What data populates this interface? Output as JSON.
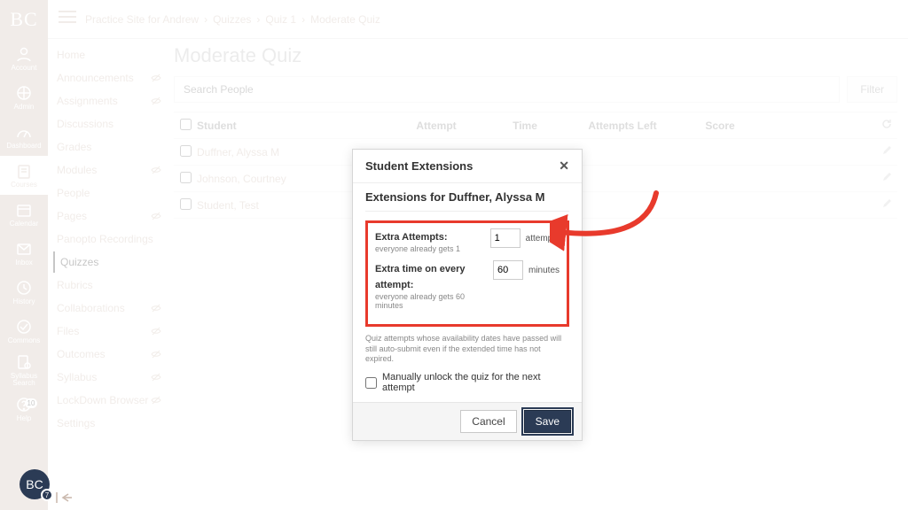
{
  "brand": "BC",
  "global_nav": [
    {
      "id": "account",
      "label": "Account"
    },
    {
      "id": "admin",
      "label": "Admin"
    },
    {
      "id": "dashboard",
      "label": "Dashboard"
    },
    {
      "id": "courses",
      "label": "Courses"
    },
    {
      "id": "calendar",
      "label": "Calendar"
    },
    {
      "id": "inbox",
      "label": "Inbox"
    },
    {
      "id": "history",
      "label": "History"
    },
    {
      "id": "commons",
      "label": "Commons"
    },
    {
      "id": "syllabus-search",
      "label": "Syllabus Search"
    },
    {
      "id": "help",
      "label": "Help",
      "badge": "10"
    }
  ],
  "global_nav_active": "courses",
  "breadcrumbs": [
    "Practice Site for Andrew",
    "Quizzes",
    "Quiz 1",
    "Moderate Quiz"
  ],
  "course_nav": {
    "items": [
      {
        "label": "Home"
      },
      {
        "label": "Announcements",
        "hidden": true
      },
      {
        "label": "Assignments",
        "hidden": true
      },
      {
        "label": "Discussions"
      },
      {
        "label": "Grades"
      },
      {
        "label": "Modules",
        "hidden": true
      },
      {
        "label": "People"
      },
      {
        "label": "Pages",
        "hidden": true
      },
      {
        "label": "Panopto Recordings"
      },
      {
        "label": "Quizzes"
      },
      {
        "label": "Rubrics"
      },
      {
        "label": "Collaborations",
        "hidden": true
      },
      {
        "label": "Files",
        "hidden": true
      },
      {
        "label": "Outcomes",
        "hidden": true
      },
      {
        "label": "Syllabus",
        "hidden": true
      },
      {
        "label": "LockDown Browser",
        "hidden": true
      },
      {
        "label": "Settings"
      }
    ],
    "active": "Quizzes"
  },
  "page": {
    "title": "Moderate Quiz",
    "search_placeholder": "Search People",
    "filter_label": "Filter",
    "columns": {
      "student": "Student",
      "attempt": "Attempt",
      "time": "Time",
      "left": "Attempts Left",
      "score": "Score"
    },
    "rows": [
      {
        "name": "Duffner, Alyssa M"
      },
      {
        "name": "Johnson, Courtney"
      },
      {
        "name": "Student, Test"
      }
    ]
  },
  "modal": {
    "header": "Student Extensions",
    "title": "Extensions for Duffner, Alyssa M",
    "extra_attempts": {
      "label": "Extra Attempts:",
      "sub": "everyone already gets 1",
      "value": "1",
      "unit": "attempts"
    },
    "extra_time": {
      "label": "Extra time on every attempt:",
      "sub": "everyone already gets 60 minutes",
      "value": "60",
      "unit": "minutes"
    },
    "note": "Quiz attempts whose availability dates have passed will still auto-submit even if the extended time has not expired.",
    "unlock_label": "Manually unlock the quiz for the next attempt",
    "unlock_checked": false,
    "cancel": "Cancel",
    "save": "Save"
  },
  "avatar": {
    "text": "BC",
    "count": "7"
  },
  "annotation": {
    "color": "#e83a2c"
  }
}
